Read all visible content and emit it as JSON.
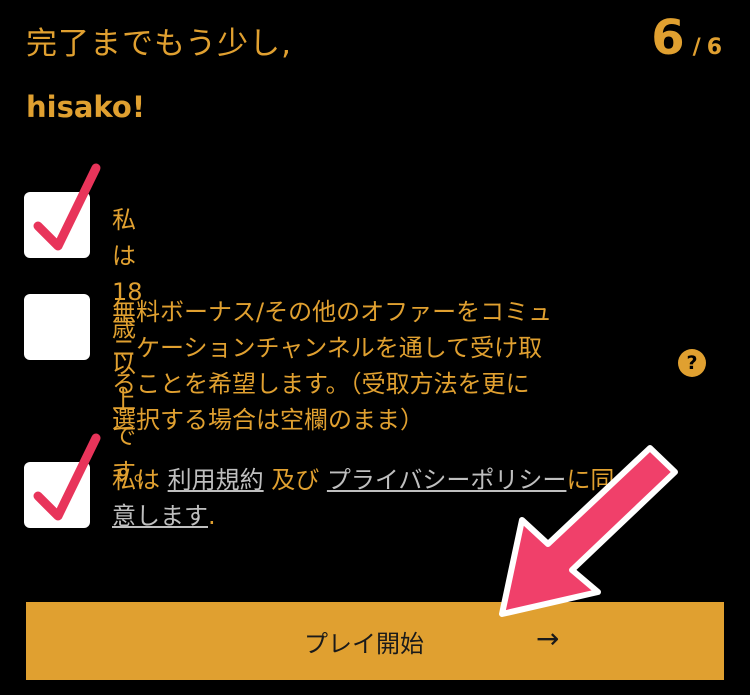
{
  "header": {
    "title": "完了までもう少し,",
    "username": "hisako!",
    "step_current": "6",
    "step_separator": "/",
    "step_total": "6"
  },
  "options": [
    {
      "text": "私は18歳以上です。",
      "checked": true
    },
    {
      "text": "無料ボーナス/その他のオファーをコミュ\nニケーションチャンネルを通して受け取\nることを希望します。（受取方法を更に\n選択する場合は空欄のまま）",
      "checked": false
    },
    {
      "text_before": "私は ",
      "link1": "利用規約",
      "text_middle": " 及び ",
      "link2": "プライバシーポリシー",
      "text_after": "に同",
      "line2_link": "意します",
      "line2_after": ".",
      "checked": true
    }
  ],
  "help_icon": "?",
  "play_button": {
    "label": "プレイ開始",
    "arrow": "→"
  },
  "colors": {
    "accent": "#e0a030",
    "check": "#e8345a",
    "background": "#000000"
  }
}
